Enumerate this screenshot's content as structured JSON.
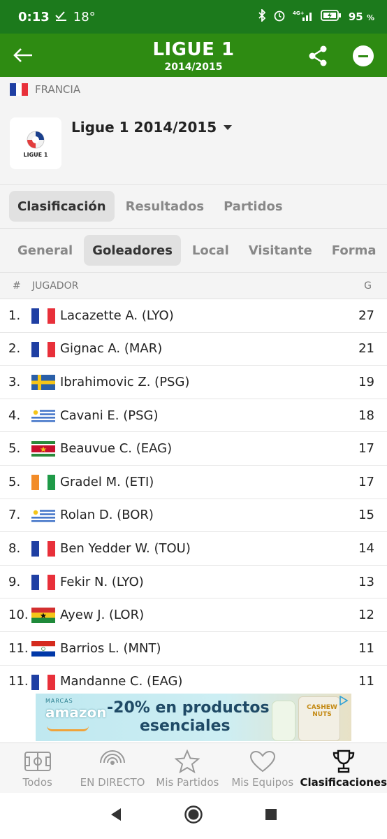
{
  "status_bar": {
    "time": "0:13",
    "temperature": "18°",
    "battery": "95",
    "battery_unit": "%",
    "network": "4G+"
  },
  "app_bar": {
    "title": "LIGUE 1",
    "subtitle": "2014/2015"
  },
  "country": {
    "name": "FRANCIA"
  },
  "league": {
    "name": "Ligue 1 2014/2015",
    "logo_text": "LIGUE 1"
  },
  "main_tabs": [
    {
      "label": "Clasificación",
      "active": true
    },
    {
      "label": "Resultados",
      "active": false
    },
    {
      "label": "Partidos",
      "active": false
    }
  ],
  "sub_tabs": [
    {
      "label": "General",
      "active": false
    },
    {
      "label": "Goleadores",
      "active": true
    },
    {
      "label": "Local",
      "active": false
    },
    {
      "label": "Visitante",
      "active": false
    },
    {
      "label": "Forma",
      "active": false
    }
  ],
  "table": {
    "headers": {
      "num": "#",
      "player": "JUGADOR",
      "goals": "G"
    },
    "rows": [
      {
        "pos": "1.",
        "flag": "france",
        "name": "Lacazette A. (LYO)",
        "goals": "27"
      },
      {
        "pos": "2.",
        "flag": "france",
        "name": "Gignac A. (MAR)",
        "goals": "21"
      },
      {
        "pos": "3.",
        "flag": "sweden",
        "name": "Ibrahimovic Z. (PSG)",
        "goals": "19"
      },
      {
        "pos": "4.",
        "flag": "uruguay",
        "name": "Cavani E. (PSG)",
        "goals": "18"
      },
      {
        "pos": "5.",
        "flag": "suriname",
        "name": "Beauvue C. (EAG)",
        "goals": "17"
      },
      {
        "pos": "5.",
        "flag": "ivory-coast",
        "name": "Gradel M. (ETI)",
        "goals": "17"
      },
      {
        "pos": "7.",
        "flag": "uruguay",
        "name": "Rolan D. (BOR)",
        "goals": "15"
      },
      {
        "pos": "8.",
        "flag": "france",
        "name": "Ben Yedder W. (TOU)",
        "goals": "14"
      },
      {
        "pos": "9.",
        "flag": "france",
        "name": "Fekir N. (LYO)",
        "goals": "13"
      },
      {
        "pos": "10.",
        "flag": "ghana",
        "name": "Ayew J. (LOR)",
        "goals": "12"
      },
      {
        "pos": "11.",
        "flag": "paraguay",
        "name": "Barrios L. (MNT)",
        "goals": "11"
      },
      {
        "pos": "11.",
        "flag": "france",
        "name": "Mandanne C. (EAG)",
        "goals": "11"
      }
    ]
  },
  "ad": {
    "marcas": "MARCAS",
    "brand": "amazon",
    "line1": "-20% en productos",
    "line2": "esenciales",
    "product_label": "CASHEW NUTS"
  },
  "bottom_nav": [
    {
      "label": "Todos",
      "icon": "pitch-icon",
      "active": false
    },
    {
      "label": "EN DIRECTO",
      "icon": "live-icon",
      "active": false
    },
    {
      "label": "Mis Partidos",
      "icon": "star-icon",
      "active": false
    },
    {
      "label": "Mis Equipos",
      "icon": "heart-icon",
      "active": false
    },
    {
      "label": "Clasificaciones",
      "icon": "trophy-icon",
      "active": true
    }
  ],
  "colors": {
    "primary_green": "#2e8b12",
    "status_green": "#1c7a1c",
    "background": "#f4f4f4"
  }
}
